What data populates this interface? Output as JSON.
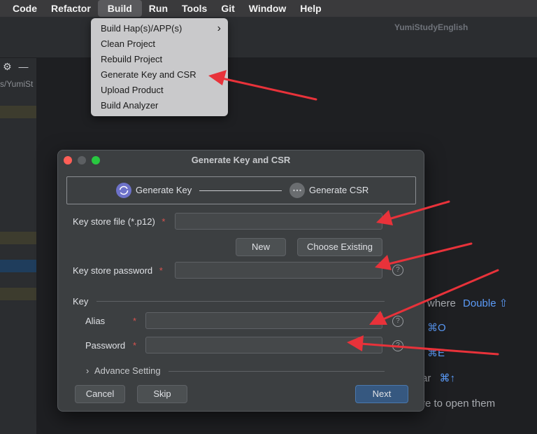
{
  "menubar": {
    "items": [
      "Code",
      "Refactor",
      "Build",
      "Run",
      "Tools",
      "Git",
      "Window",
      "Help"
    ],
    "active": "Build"
  },
  "titlebar": {
    "project_name": "YumiStudyEnglish"
  },
  "leftpanel": {
    "path_fragment": "s/YumiSt"
  },
  "build_menu": {
    "items": [
      "Build Hap(s)/APP(s)",
      "Clean Project",
      "Rebuild Project",
      "Generate Key and CSR",
      "Upload Product",
      "Build Analyzer"
    ],
    "submenu_chevron": "›"
  },
  "editor_hints": {
    "line1_text": "where",
    "line1_key": "Double ⇧",
    "line2_key": "⌘O",
    "line3_key": "⌘E",
    "line4_text": "ar",
    "line4_key": "⌘↑",
    "line5_text": "re to open them"
  },
  "dialog": {
    "title": "Generate Key and CSR",
    "step1": "Generate Key",
    "step2": "Generate CSR",
    "keystore_file_label": "Key store file (*.p12)",
    "keystore_file_value": "",
    "required_mark": "*",
    "new_button": "New",
    "choose_existing_button": "Choose Existing",
    "keystore_password_label": "Key store password",
    "keystore_password_value": "",
    "key_section": "Key",
    "alias_label": "Alias",
    "alias_value": "",
    "password_label": "Password",
    "password_value": "",
    "advance_setting": "Advance Setting",
    "help_glyph": "?",
    "cancel_button": "Cancel",
    "skip_button": "Skip",
    "next_button": "Next"
  },
  "colors": {
    "accent_blue": "#5b9bf8",
    "annotation_red": "#e8323a",
    "primary_button": "#365880"
  }
}
